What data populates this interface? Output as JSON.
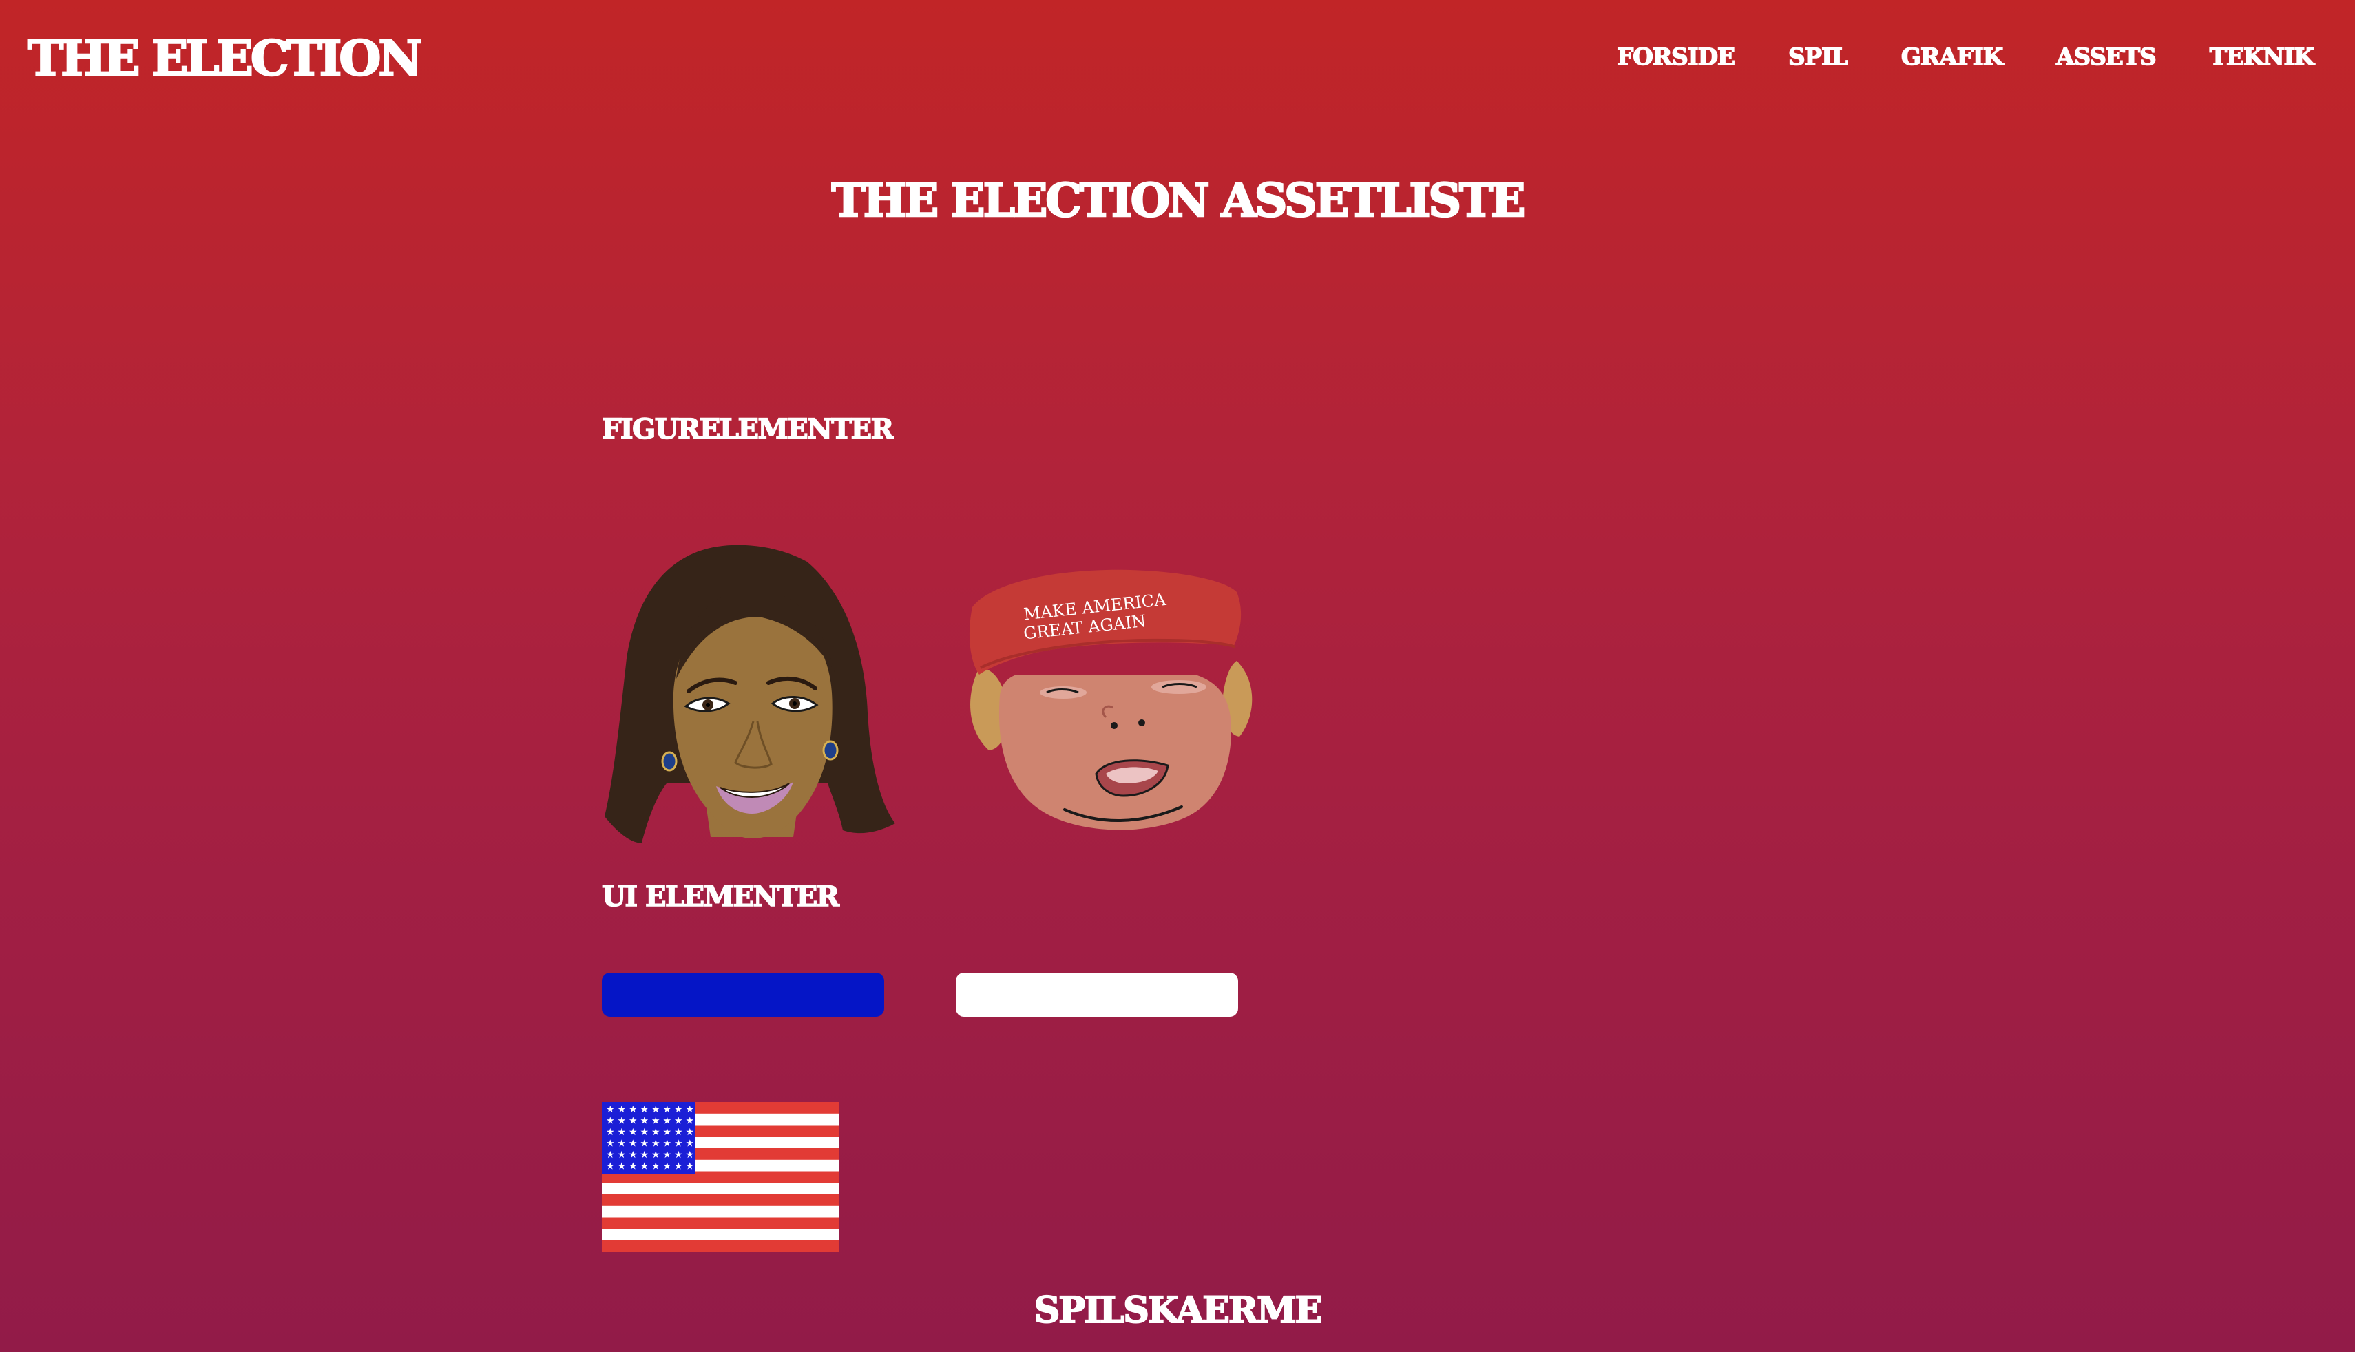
{
  "header": {
    "logo": "THE ELECTION",
    "nav": [
      "FORSIDE",
      "SPIL",
      "GRAFIK",
      "ASSETS",
      "TEKNIK"
    ]
  },
  "main": {
    "title": "THE ELECTION ASSETLISTE",
    "figures": {
      "heading": "FIGURELEMENTER",
      "cap_text": [
        "MAKE AMERICA",
        "GREAT AGAIN"
      ]
    },
    "ui": {
      "heading": "UI ELEMENTER"
    },
    "screens": {
      "heading": "SPILSKAERME"
    }
  },
  "colors": {
    "background_top": "#c12527",
    "background_bottom": "#921b48",
    "blue_bar": "#0515c6",
    "white_bar": "#ffffff",
    "flag_red": "#e23b35",
    "flag_blue": "#1b1fd6",
    "cap_red": "#c53a36"
  }
}
